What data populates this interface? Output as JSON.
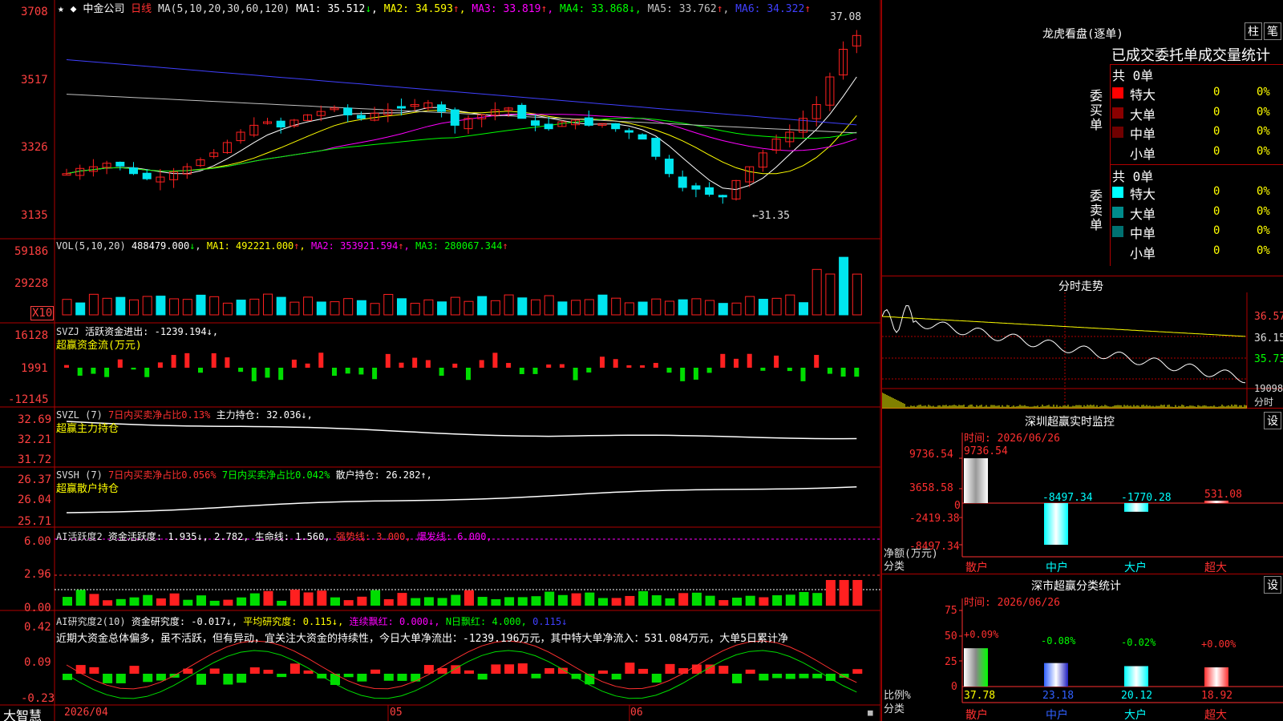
{
  "app": {
    "brand": "大智慧"
  },
  "stock": {
    "name": "中金公司",
    "period": "日线"
  },
  "colors": {
    "up": "#ff2020",
    "down": "#00e5ee",
    "grid": "#a00000",
    "axis": "#ff3b3b",
    "bg": "#000000"
  },
  "main": {
    "ma_label": "MA(5,10,20,30,60,120)",
    "ma": [
      {
        "name": "MA1",
        "value": "35.512",
        "arrow": "↓",
        "color": "#ffffff"
      },
      {
        "name": "MA2",
        "value": "34.593",
        "arrow": "↑",
        "color": "#ffff00"
      },
      {
        "name": "MA3",
        "value": "33.819",
        "arrow": "↑",
        "color": "#ff00ff"
      },
      {
        "name": "MA4",
        "value": "33.868",
        "arrow": "↓",
        "color": "#00ff00"
      },
      {
        "name": "MA5",
        "value": "33.762",
        "arrow": "↑",
        "color": "#c0c0c0"
      },
      {
        "name": "MA6",
        "value": "34.322",
        "arrow": "↑",
        "color": "#4040ff"
      }
    ],
    "yticks": [
      "3708",
      "3517",
      "3326",
      "3135"
    ],
    "high_label": "37.08",
    "low_label": "←31.35"
  },
  "vol": {
    "title": "VOL(5,10,20)",
    "value": "488479.000",
    "arrow": "↓",
    "ma": [
      {
        "name": "MA1",
        "value": "492221.000",
        "arrow": "↑",
        "color": "#ffff00"
      },
      {
        "name": "MA2",
        "value": "353921.594",
        "arrow": "↑",
        "color": "#ff00ff"
      },
      {
        "name": "MA3",
        "value": "280067.344",
        "arrow": "↑",
        "color": "#00ff00"
      }
    ],
    "yticks": [
      "59186",
      "29228"
    ],
    "unit": "X10"
  },
  "svzj": {
    "title": "SVZJ",
    "text": "活跃资金进出: -1239.194↓,",
    "subtitle": "超赢资金流(万元)",
    "yticks": [
      "16128",
      "1991",
      "-12145"
    ]
  },
  "svzl": {
    "title": "SVZL (7)",
    "red_text": "7日内买卖净占比0.13%",
    "text": "主力持仓: 32.036↓,",
    "subtitle": "超赢主力持仓",
    "yticks": [
      "32.69",
      "32.21",
      "31.72"
    ]
  },
  "svsh": {
    "title": "SVSH (7)",
    "red_text": "7日内买卖净占比0.056%",
    "green_text": "7日内买卖净占比0.042%",
    "text": "散户持仓: 26.282↑,",
    "subtitle": "超赢散户持仓",
    "yticks": [
      "26.37",
      "26.04",
      "25.71"
    ]
  },
  "ai_active": {
    "title": "AI活跃度2",
    "t1": "资金活跃度: 1.935↓, 2.782,",
    "t2": "生命线: 1.560,",
    "t3": "强势线: 3.000,",
    "t4": "爆发线: 6.000,",
    "yticks": [
      "6.00",
      "2.96",
      "0.00"
    ]
  },
  "ai_research": {
    "title": "AI研究度2(10)",
    "t1": "资金研究度: -0.017↓,",
    "t2": "平均研究度: 0.115↓,",
    "t3": "连续飘红: 0.000↓,",
    "t4": "N日飘红: 4.000,",
    "t5": "0.115↓",
    "note": "近期大资金总体偏多，虽不活跃，但有异动，宜关注大资金的持续性，今日大单净流出：-1239.196万元，其中特大单净流入：531.084万元，大单5日累计净",
    "yticks": [
      "0.42",
      "0.09",
      "-0.23"
    ]
  },
  "xaxis": {
    "labels": [
      "2026/04",
      "05",
      "06"
    ]
  },
  "lhb": {
    "title": "龙虎看盘(逐单)",
    "btn1": "柱",
    "btn2": "笔",
    "header": "已成交委托单成交量统计",
    "buy_label": "委买单",
    "sell_label": "委卖单",
    "buy_total": "共 0单",
    "sell_total": "共 0单",
    "buy_rows": [
      {
        "label": "特大",
        "count": "0",
        "pct": "0%",
        "color": "#ff0000"
      },
      {
        "label": "大单",
        "count": "0",
        "pct": "0%",
        "color": "#8b0000"
      },
      {
        "label": "中单",
        "count": "0",
        "pct": "0%",
        "color": "#700000"
      },
      {
        "label": "小单",
        "count": "0",
        "pct": "0%",
        "color": ""
      }
    ],
    "sell_rows": [
      {
        "label": "特大",
        "count": "0",
        "pct": "0%",
        "color": "#00ffff"
      },
      {
        "label": "大单",
        "count": "0",
        "pct": "0%",
        "color": "#008b8b"
      },
      {
        "label": "中单",
        "count": "0",
        "pct": "0%",
        "color": "#007070"
      },
      {
        "label": "小单",
        "count": "0",
        "pct": "0%",
        "color": ""
      }
    ]
  },
  "intraday": {
    "title": "分时走势",
    "yticks": [
      "36.57",
      "36.15",
      "35.73"
    ],
    "vol_tick": "19098",
    "vol_unit": "分时"
  },
  "monitor": {
    "title": "深圳超赢实时监控",
    "btn": "设",
    "time": "时间: 2026/06/26",
    "yticks": [
      "9736.54",
      "3658.58",
      "0",
      "-2419.38",
      "-8497.34"
    ],
    "ylabel": "净额(万元)",
    "xlabel": "分类",
    "categories": [
      "散户",
      "中户",
      "大户",
      "超大"
    ],
    "value_labels": [
      "9736.54",
      "-8497.34",
      "-1770.28",
      "531.08"
    ]
  },
  "classify": {
    "title": "深市超赢分类统计",
    "btn": "设",
    "time": "时间: 2026/06/26",
    "yticks": [
      "75",
      "50",
      "25",
      "0"
    ],
    "ylabel": "比例%",
    "xlabel": "分类",
    "categories": [
      "散户",
      "中户",
      "大户",
      "超大"
    ],
    "top_labels": [
      "+0.09%",
      "-0.08%",
      "-0.02%",
      "+0.00%"
    ],
    "bottom_labels": [
      "37.78",
      "23.18",
      "20.12",
      "18.92"
    ]
  },
  "chart_data": [
    {
      "type": "bar",
      "title": "",
      "categories": [
        "散户",
        "中户",
        "大户",
        "超大"
      ],
      "values": [
        9736.54,
        -8497.34,
        -1770.28,
        531.08
      ],
      "ylabel": "净额(万元)",
      "xlabel": "分类",
      "ylim": [
        -8497.34,
        9736.54
      ]
    },
    {
      "type": "bar",
      "title": "",
      "categories": [
        "散户",
        "中户",
        "大户",
        "超大"
      ],
      "values": [
        37.78,
        23.18,
        20.12,
        18.92
      ],
      "ylabel": "比例%",
      "xlabel": "分类",
      "ylim": [
        0,
        75
      ]
    }
  ]
}
